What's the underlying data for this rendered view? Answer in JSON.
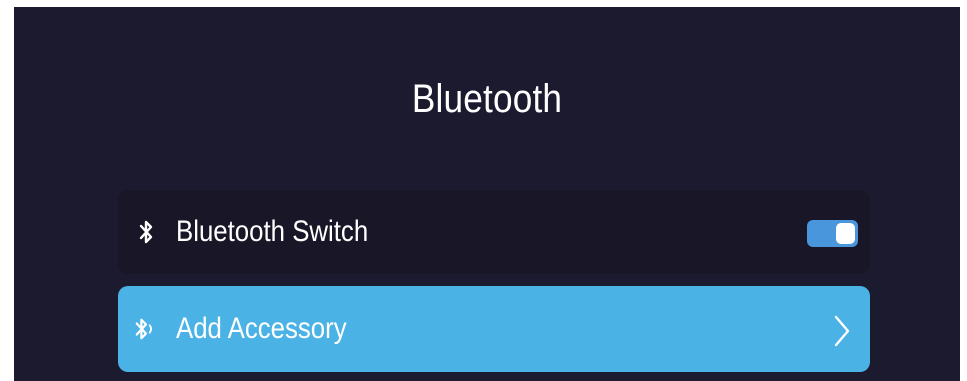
{
  "page": {
    "title": "Bluetooth"
  },
  "rows": {
    "bluetooth_switch": {
      "label": "Bluetooth Switch",
      "icon": "bluetooth-icon",
      "toggle_on": true
    },
    "add_accessory": {
      "label": "Add Accessory",
      "icon": "bluetooth-searching-icon",
      "trailing_icon": "chevron-right-icon",
      "selected": true
    }
  },
  "colors": {
    "background": "#1c1a2f",
    "row_background": "#191727",
    "selected_row": "#4ab2e5",
    "toggle_on": "#4a96dc",
    "text": "#ffffff"
  }
}
